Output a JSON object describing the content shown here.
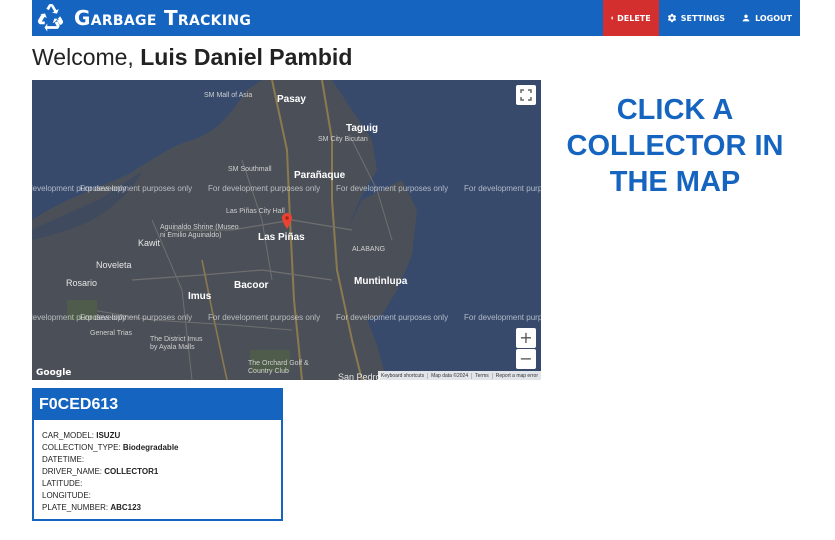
{
  "app": {
    "title": "Garbage Tracking",
    "logo_icon": "recycle-icon"
  },
  "nav": {
    "delete_label": "DELETE",
    "delete_icon": "trash-icon",
    "settings_label": "SETTINGS",
    "settings_icon": "gear-icon",
    "logout_label": "LOGOUT",
    "logout_icon": "person-icon"
  },
  "welcome": {
    "prefix": "Welcome,",
    "user_name": "Luis Daniel Pambid"
  },
  "map": {
    "labels": {
      "pasay": "Pasay",
      "taguig": "Taguig",
      "paranaque": "Parañaque",
      "las_pinas": "Las Piñas",
      "bacoor": "Bacoor",
      "imus": "Imus",
      "muntinlupa": "Muntinlupa",
      "kawit": "Kawit",
      "noveleta": "Noveleta",
      "rosario": "Rosario",
      "general_trias": "General Trias",
      "san_pedro": "San Pedro",
      "alabang": "ALABANG",
      "dasmarinas": "The District Imus\nby Ayala Malls",
      "sm_mall": "SM Mall of Asia",
      "sm_city_bicutan": "SM City Bicutan",
      "sm_southmall": "SM Southmall",
      "orchard": "The Orchard Golf &\nCountry Club",
      "las_pinas_city_hall": "Las Piñas City Hall",
      "aguinaldo": "Aguinaldo Shrine (Museo\nni Emilio Aguinaldo)"
    },
    "dev_watermark": "For development purposes only",
    "zoom_in": "+",
    "zoom_out": "−",
    "fullscreen_icon": "fullscreen-icon",
    "google": "Google",
    "attribution": {
      "shortcuts": "Keyboard shortcuts",
      "data": "Map data ©2024",
      "terms": "Terms",
      "report": "Report a map error"
    }
  },
  "prompt": {
    "text": "CLICK A COLLECTOR IN THE MAP"
  },
  "collector": {
    "id": "F0CED613",
    "fields": [
      {
        "key": "CAR_MODEL:",
        "value": "ISUZU"
      },
      {
        "key": "COLLECTION_TYPE:",
        "value": "Biodegradable"
      },
      {
        "key": "DATETIME:",
        "value": ""
      },
      {
        "key": "DRIVER_NAME:",
        "value": "COLLECTOR1"
      },
      {
        "key": "LATITUDE:",
        "value": ""
      },
      {
        "key": "LONGITUDE:",
        "value": ""
      },
      {
        "key": "PLATE_NUMBER:",
        "value": "ABC123"
      }
    ]
  },
  "colors": {
    "primary": "#1565c0",
    "danger": "#d32f2f",
    "water": "#374a6c",
    "land": "#4a4f58"
  }
}
